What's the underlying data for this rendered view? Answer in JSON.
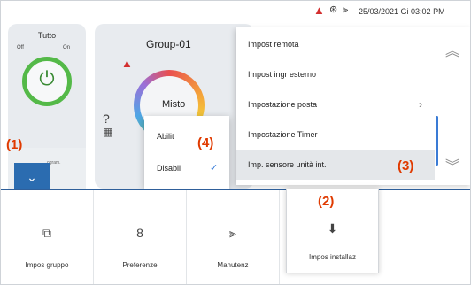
{
  "status": {
    "datetime": "25/03/2021 Gi 03:02 PM",
    "icons": [
      "warning-icon",
      "remote-icon",
      "maintenance-icon"
    ]
  },
  "tutto": {
    "label": "Tutto",
    "off": "Off",
    "on": "On"
  },
  "lowtile": {
    "label": "ogram."
  },
  "group": {
    "name": "Group-01",
    "mode": "Misto"
  },
  "menu": {
    "items": [
      {
        "label": "Impost remota"
      },
      {
        "label": "Impost ingr esterno"
      },
      {
        "label": "Impostazione posta"
      },
      {
        "label": "Impostazione Timer"
      },
      {
        "label": "Imp. sensore unità int."
      }
    ]
  },
  "popup": {
    "options": [
      {
        "label": "Abilit"
      },
      {
        "label": "Disabil"
      }
    ]
  },
  "bottom": {
    "tiles": [
      {
        "label": "Impos gruppo",
        "icon": "group-settings-icon"
      },
      {
        "label": "Preferenze",
        "icon": "preferences-icon"
      },
      {
        "label": "Manutenz",
        "icon": "maintenance-icon"
      },
      {
        "label": "Impos installaz",
        "icon": "install-settings-icon"
      }
    ]
  },
  "annotations": [
    "(1)",
    "(2)",
    "(3)",
    "(4)"
  ],
  "colors": {
    "accent": "#2b6cb0",
    "annotation": "#e03a00",
    "power": "#54b948",
    "warning": "#d32f2f"
  }
}
